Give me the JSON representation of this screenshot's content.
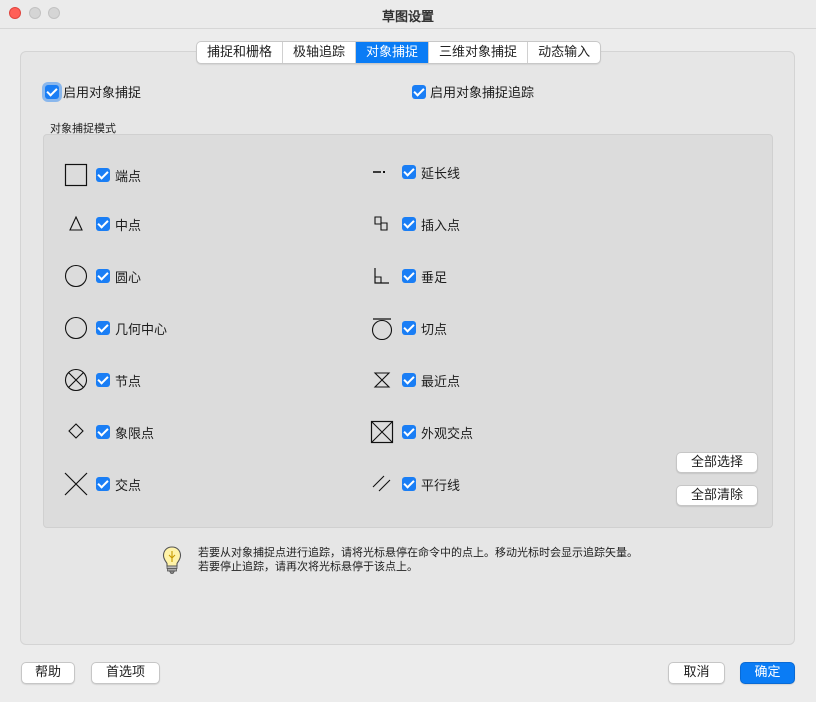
{
  "window": {
    "title": "草图设置"
  },
  "tabs": [
    {
      "label": "捕捉和栅格",
      "active": false
    },
    {
      "label": "极轴追踪",
      "active": false
    },
    {
      "label": "对象捕捉",
      "active": true
    },
    {
      "label": "三维对象捕捉",
      "active": false
    },
    {
      "label": "动态输入",
      "active": false
    }
  ],
  "options": {
    "enable_osnap": {
      "label": "启用对象捕捉",
      "checked": true
    },
    "enable_osnap_tracking": {
      "label": "启用对象捕捉追踪",
      "checked": true
    }
  },
  "section_label": "对象捕捉模式",
  "modes_left": [
    {
      "label": "端点",
      "icon": "endpoint-square-icon",
      "checked": true
    },
    {
      "label": "中点",
      "icon": "midpoint-triangle-icon",
      "checked": true
    },
    {
      "label": "圆心",
      "icon": "center-circle-icon",
      "checked": true
    },
    {
      "label": "几何中心",
      "icon": "geometric-center-icon",
      "checked": true
    },
    {
      "label": "节点",
      "icon": "node-icon",
      "checked": true
    },
    {
      "label": "象限点",
      "icon": "quadrant-diamond-icon",
      "checked": true
    },
    {
      "label": "交点",
      "icon": "intersection-x-icon",
      "checked": true
    }
  ],
  "modes_right": [
    {
      "label": "延长线",
      "icon": "extension-icon",
      "checked": true
    },
    {
      "label": "插入点",
      "icon": "insertion-icon",
      "checked": true
    },
    {
      "label": "垂足",
      "icon": "perpendicular-icon",
      "checked": true
    },
    {
      "label": "切点",
      "icon": "tangent-icon",
      "checked": true
    },
    {
      "label": "最近点",
      "icon": "nearest-hourglass-icon",
      "checked": true
    },
    {
      "label": "外观交点",
      "icon": "apparent-intersection-icon",
      "checked": true
    },
    {
      "label": "平行线",
      "icon": "parallel-icon",
      "checked": true
    }
  ],
  "buttons": {
    "select_all": "全部选择",
    "clear_all": "全部清除",
    "help": "帮助",
    "preferences": "首选项",
    "cancel": "取消",
    "ok": "确定"
  },
  "hint": {
    "line1": "若要从对象捕捉点进行追踪，请将光标悬停在命令中的点上。移动光标时会显示追踪矢量。",
    "line2": "若要停止追踪，请再次将光标悬停于该点上。"
  },
  "colors": {
    "accent": "#0a7cf5",
    "close": "#ff5f57"
  }
}
